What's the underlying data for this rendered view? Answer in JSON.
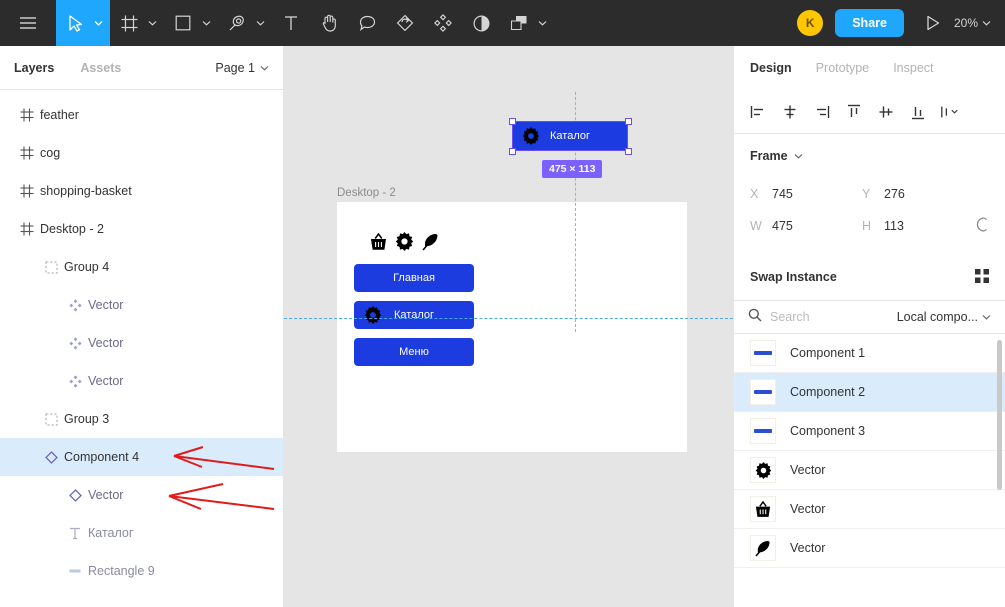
{
  "toolbar": {
    "menu_icon": "hamburger-menu-icon",
    "tools": [
      {
        "icon": "move-cursor-icon",
        "caret": true,
        "active": true
      },
      {
        "icon": "frame-icon",
        "caret": true,
        "active": false
      },
      {
        "icon": "shape-rectangle-icon",
        "caret": true,
        "active": false
      },
      {
        "icon": "pen-icon",
        "caret": true,
        "active": false
      },
      {
        "icon": "text-tool-icon",
        "caret": false,
        "active": false
      },
      {
        "icon": "hand-icon",
        "caret": false,
        "active": false
      },
      {
        "icon": "comment-icon",
        "caret": false,
        "active": false
      },
      {
        "icon": "actions-icon",
        "caret": false,
        "active": false
      },
      {
        "icon": "components-icon",
        "caret": false,
        "active": false
      },
      {
        "icon": "contrast-icon",
        "caret": false,
        "active": false
      },
      {
        "icon": "mask-icon",
        "caret": true,
        "active": false
      }
    ],
    "avatar_initial": "K",
    "share_label": "Share",
    "present_icon": "play-present-icon",
    "zoom_level": "20%"
  },
  "left_panel": {
    "tabs": [
      {
        "label": "Layers",
        "active": true
      },
      {
        "label": "Assets",
        "active": false
      }
    ],
    "page_selector": "Page 1",
    "layers": [
      {
        "label": "feather",
        "icon": "frame-icon",
        "indent": 0,
        "selected": false,
        "tone": "normal"
      },
      {
        "label": "cog",
        "icon": "frame-icon",
        "indent": 0,
        "selected": false,
        "tone": "normal"
      },
      {
        "label": "shopping-basket",
        "icon": "frame-icon",
        "indent": 0,
        "selected": false,
        "tone": "normal"
      },
      {
        "label": "Desktop - 2",
        "icon": "frame-icon",
        "indent": 0,
        "selected": false,
        "tone": "normal"
      },
      {
        "label": "Group 4",
        "icon": "group-icon",
        "indent": 1,
        "selected": false,
        "tone": "normal"
      },
      {
        "label": "Vector",
        "icon": "component-icon",
        "indent": 2,
        "selected": false,
        "tone": "dim"
      },
      {
        "label": "Vector",
        "icon": "component-icon",
        "indent": 2,
        "selected": false,
        "tone": "dim"
      },
      {
        "label": "Vector",
        "icon": "component-icon",
        "indent": 2,
        "selected": false,
        "tone": "dim"
      },
      {
        "label": "Group 3",
        "icon": "group-icon",
        "indent": 1,
        "selected": false,
        "tone": "normal"
      },
      {
        "label": "Component 4",
        "icon": "instance-icon",
        "indent": 1,
        "selected": true,
        "tone": "normal"
      },
      {
        "label": "Vector",
        "icon": "instance-icon",
        "indent": 2,
        "selected": false,
        "tone": "dim"
      },
      {
        "label": "Каталог",
        "icon": "text-icon",
        "indent": 2,
        "selected": false,
        "tone": "veryDim"
      },
      {
        "label": "Rectangle 9",
        "icon": "rectangle-icon",
        "indent": 2,
        "selected": false,
        "tone": "veryDim"
      }
    ],
    "annotation_arrows": 2,
    "annotation_color": "#e01b1b"
  },
  "canvas": {
    "frame_label": "Desktop - 2",
    "frame_icons": [
      "shopping-basket-icon",
      "cog-icon",
      "feather-icon"
    ],
    "buttons": [
      {
        "label": "Главная",
        "has_gear": false
      },
      {
        "label": "Каталог",
        "has_gear": true
      },
      {
        "label": "Меню",
        "has_gear": false
      }
    ],
    "selected_node": {
      "label": "Каталог",
      "has_gear": true
    },
    "size_badge": "475 × 113",
    "button_color": "#1c3ce0",
    "selection_color": "#6a4ff0",
    "badge_color": "#7b61ff",
    "guide_color": "#4ea8e8"
  },
  "right_panel": {
    "tabs": [
      {
        "label": "Design",
        "active": true
      },
      {
        "label": "Prototype",
        "active": false
      },
      {
        "label": "Inspect",
        "active": false
      }
    ],
    "align_icons": [
      "align-left-icon",
      "align-horizontal-center-icon",
      "align-right-icon",
      "align-top-icon",
      "align-vertical-center-icon",
      "align-bottom-icon",
      "distribute-icon"
    ],
    "frame_type": "Frame",
    "properties": [
      {
        "key": "X",
        "value": "745"
      },
      {
        "key": "Y",
        "value": "276"
      },
      {
        "key": "W",
        "value": "475"
      },
      {
        "key": "H",
        "value": "113"
      }
    ],
    "constrain_icon": "link-proportions-icon",
    "swap_instance": {
      "title": "Swap Instance",
      "grid_icon": "grid-view-icon",
      "search_icon": "search-icon",
      "search_value": "",
      "search_placeholder": "Search",
      "scope_label": "Local compo...",
      "items": [
        {
          "label": "Component 1",
          "thumb": "blue-bar-thumb",
          "selected": false
        },
        {
          "label": "Component 2",
          "thumb": "blue-bar-thumb",
          "selected": true
        },
        {
          "label": "Component 3",
          "thumb": "blue-bar-thumb",
          "selected": false
        },
        {
          "label": "Vector",
          "thumb": "cog-icon",
          "selected": false
        },
        {
          "label": "Vector",
          "thumb": "shopping-basket-icon",
          "selected": false
        },
        {
          "label": "Vector",
          "thumb": "feather-icon",
          "selected": false
        }
      ]
    }
  }
}
